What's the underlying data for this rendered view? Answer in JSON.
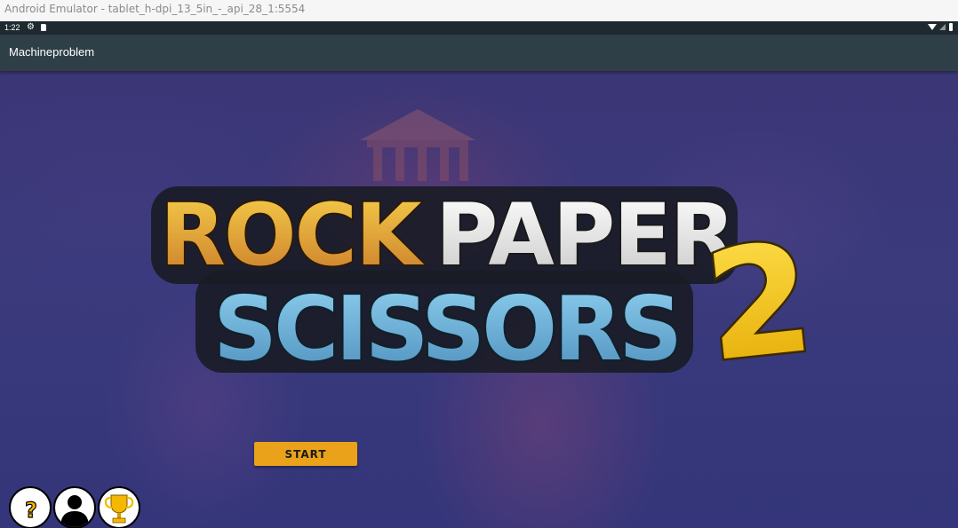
{
  "window": {
    "title": "Android Emulator - tablet_h-dpi_13_5in_-_api_28_1:5554"
  },
  "status_bar": {
    "time": "1:22",
    "icons": [
      "settings-icon",
      "sd-card-icon",
      "wifi-icon",
      "cell-signal-icon",
      "battery-icon"
    ]
  },
  "app_bar": {
    "title": "Machineproblem"
  },
  "game": {
    "logo": {
      "line1_rock": "ROCK",
      "line1_paper": "PAPER",
      "line2": "SCISSORS",
      "number": "2"
    },
    "start_label": "START",
    "round_buttons": [
      {
        "icon": "question-icon"
      },
      {
        "icon": "profile-icon"
      },
      {
        "icon": "trophy-icon"
      }
    ]
  },
  "colors": {
    "status_bar": "#1e2a30",
    "app_bar": "#2f3f48",
    "start_button": "#e9a21a",
    "logo_rock": "#e8a233",
    "logo_paper": "#f2f2f2",
    "logo_scissors": "#6cb0d6",
    "logo_two": "#f5c518"
  }
}
